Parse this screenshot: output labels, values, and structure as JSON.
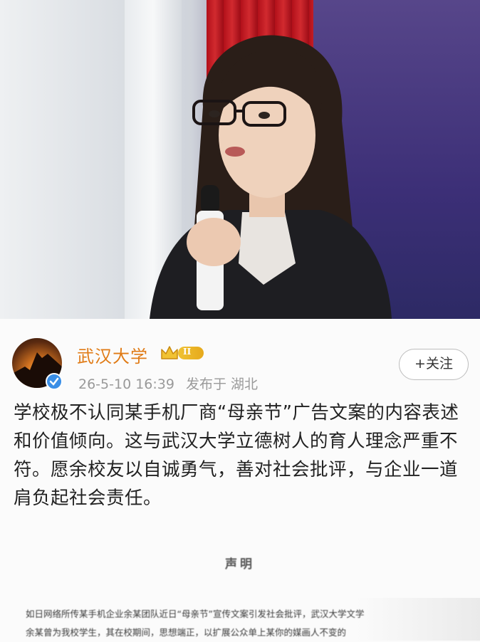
{
  "post": {
    "author": "武汉大学",
    "level_badge": "II",
    "timestamp": "26-5-10 16:39",
    "location": "发布于 湖北",
    "follow_label": "+关注",
    "content": "学校极不认同某手机厂商“母亲节”广告文案的内容表述和价值倾向。这与武汉大学立德树人的育人理念严重不符。愿余校友以自诚勇气，善对社会批评，与企业一道肩负起社会责任。",
    "statement_title": "声明",
    "statement_lines": [
      "如日网络所传某手机企业余某团队近日“母亲节”宣传文案引发社会批评，武汉大学文学",
      "余某曾为我校学生，其在校期间，思想端正，以扩展公众单上某你的媒画人不变的"
    ]
  },
  "colors": {
    "author_name": "#e07b16",
    "verified_badge": "#3a8ee6",
    "level_badge": "#f0c232"
  },
  "icons": {
    "verified": "verified-check-icon",
    "crown": "crown-icon"
  }
}
